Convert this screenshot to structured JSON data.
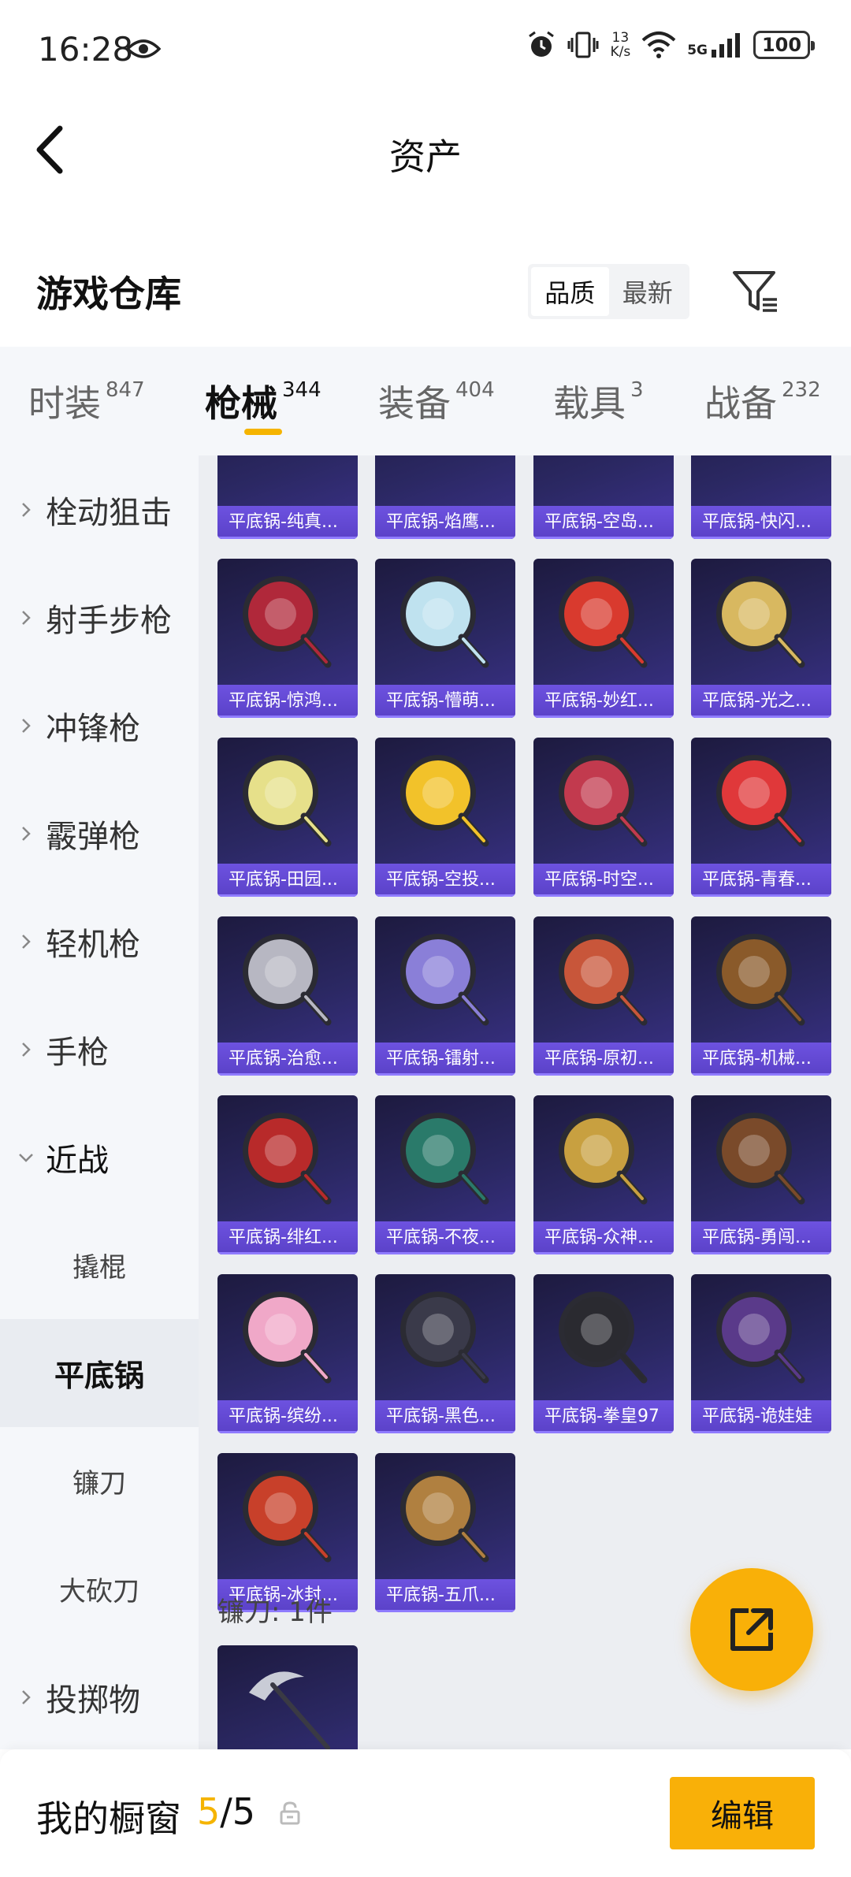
{
  "status_bar": {
    "time": "16:28",
    "net_speed_value": "13",
    "net_speed_unit": "K/s",
    "network": "5G",
    "battery": "100",
    "icons": [
      "eye-icon",
      "alarm-icon",
      "vibrate-icon",
      "wifi-icon",
      "signal-icon",
      "battery-icon"
    ]
  },
  "header": {
    "title": "资产",
    "back_icon": "chevron-left-icon"
  },
  "warehouse": {
    "title": "游戏仓库",
    "sort_options": [
      "品质",
      "最新"
    ],
    "active_sort": "品质",
    "filter_icon": "filter-icon"
  },
  "tabs": [
    {
      "label": "时装",
      "count": "847"
    },
    {
      "label": "枪械",
      "count": "344"
    },
    {
      "label": "装备",
      "count": "404"
    },
    {
      "label": "载具",
      "count": "3"
    },
    {
      "label": "战备",
      "count": "232"
    }
  ],
  "active_tab": "枪械",
  "accent_color": "#f5b400",
  "sidebar": {
    "categories": [
      "栓动狙击",
      "射手步枪",
      "冲锋枪",
      "霰弹枪",
      "轻机枪",
      "手枪",
      "近战"
    ],
    "expanded": "近战",
    "sub_items": [
      "撬棍",
      "平底锅",
      "镰刀",
      "大砍刀"
    ],
    "active_sub": "平底锅",
    "after": "投掷物"
  },
  "items": {
    "partial_row": [
      "平底锅-纯真...",
      "平底锅-焰鹰...",
      "平底锅-空岛...",
      "平底锅-快闪..."
    ],
    "pans": [
      "平底锅-惊鸿...",
      "平底锅-懵萌...",
      "平底锅-妙红...",
      "平底锅-光之...",
      "平底锅-田园...",
      "平底锅-空投...",
      "平底锅-时空...",
      "平底锅-青春...",
      "平底锅-治愈...",
      "平底锅-镭射...",
      "平底锅-原初...",
      "平底锅-机械...",
      "平底锅-绯红...",
      "平底锅-不夜...",
      "平底锅-众神...",
      "平底锅-勇闯...",
      "平底锅-缤纷...",
      "平底锅-黑色...",
      "平底锅-拳皇97",
      "平底锅-诡娃娃",
      "平底锅-冰封...",
      "平底锅-五爪..."
    ],
    "pan_colors": [
      "#b0283a",
      "#bfe2ef",
      "#d93a2e",
      "#d8b860",
      "#e6e08a",
      "#f2c22a",
      "#c23a4e",
      "#e0383a",
      "#b7b7c2",
      "#8a7fd8",
      "#c8563a",
      "#8a5a2a",
      "#b82a2a",
      "#2a7a6a",
      "#c8a040",
      "#7a4a2a",
      "#f0a8c8",
      "#3a3a4a",
      "#2a2a30",
      "#5a3a8a",
      "#c8402a",
      "#b08040"
    ],
    "section_title": "镰刀: 1件"
  },
  "fab_icon": "share-external-icon",
  "showcase": {
    "title": "我的橱窗",
    "current": "5",
    "separator": "/",
    "total": "5",
    "lock_icon": "lock-icon",
    "edit_label": "编辑"
  }
}
